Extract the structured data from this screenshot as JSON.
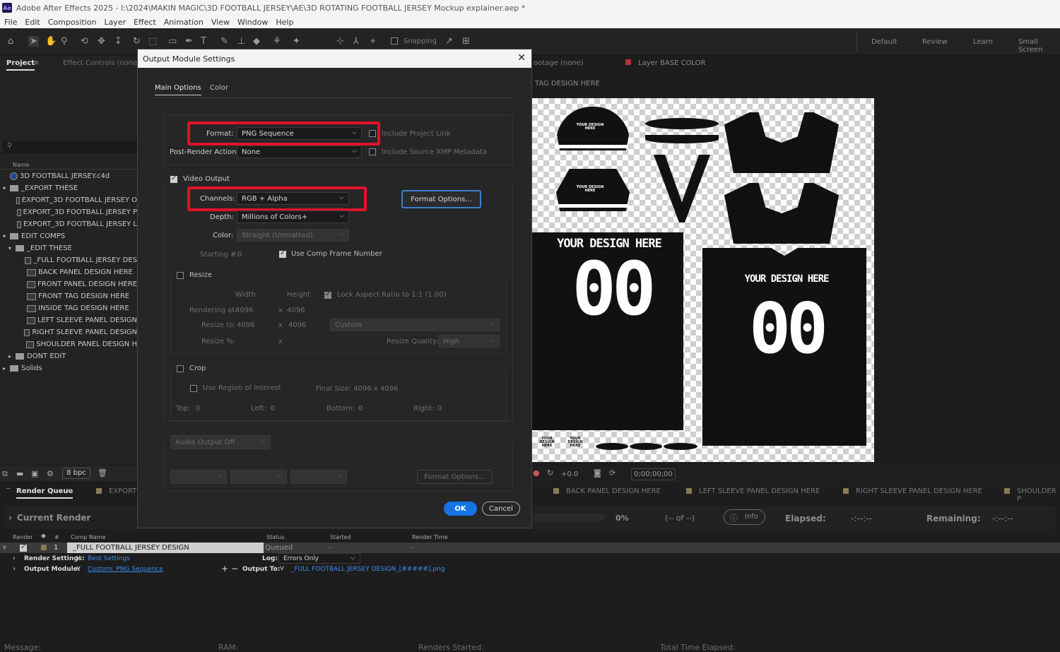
{
  "app": {
    "title": "Adobe After Effects 2025 - I:\\2024\\MAKIN MAGIC\\3D FOOTBALL JERSEY\\AE\\3D ROTATING FOOTBALL JERSEY Mockup explainer.aep *",
    "logo": "Ae"
  },
  "menu": [
    "File",
    "Edit",
    "Composition",
    "Layer",
    "Effect",
    "Animation",
    "View",
    "Window",
    "Help"
  ],
  "toolbar": {
    "snapping": "Snapping",
    "workspaces": [
      "Default",
      "Review",
      "Learn",
      "Small Screen"
    ]
  },
  "project": {
    "tab": "Project",
    "effect_tab": "Effect Controls (none)",
    "name_header": "Name",
    "search_placeholder": "",
    "items": [
      {
        "label": "3D FOOTBALL JERSEY.c4d",
        "type": "file",
        "indent": 0,
        "tri": ""
      },
      {
        "label": "_EXPORT THESE",
        "type": "folder",
        "indent": 0,
        "tri": "v"
      },
      {
        "label": "EXPORT_3D FOOTBALL JERSEY O",
        "type": "comp",
        "indent": 2,
        "tri": ""
      },
      {
        "label": "EXPORT_3D FOOTBALL JERSEY P",
        "type": "comp",
        "indent": 2,
        "tri": ""
      },
      {
        "label": "EXPORT_3D FOOTBALL JERSEY L",
        "type": "comp",
        "indent": 2,
        "tri": ""
      },
      {
        "label": "EDIT COMPS",
        "type": "folder",
        "indent": 0,
        "tri": "v"
      },
      {
        "label": "_EDIT THESE",
        "type": "folder",
        "indent": 1,
        "tri": "v"
      },
      {
        "label": "_FULL FOOTBALL JERSEY DES",
        "type": "comp",
        "indent": 3,
        "tri": ""
      },
      {
        "label": "BACK PANEL DESIGN HERE",
        "type": "comp",
        "indent": 3,
        "tri": ""
      },
      {
        "label": "FRONT PANEL DESIGN HERE",
        "type": "comp",
        "indent": 3,
        "tri": ""
      },
      {
        "label": "FRONT TAG DESIGN HERE",
        "type": "comp",
        "indent": 3,
        "tri": ""
      },
      {
        "label": "INSIDE TAG DESIGN HERE",
        "type": "comp",
        "indent": 3,
        "tri": ""
      },
      {
        "label": "LEFT SLEEVE PANEL DESIGN",
        "type": "comp",
        "indent": 3,
        "tri": ""
      },
      {
        "label": "RIGHT SLEEVE PANEL DESIGN",
        "type": "comp",
        "indent": 3,
        "tri": ""
      },
      {
        "label": "SHOULDER PANEL DESIGN H",
        "type": "comp",
        "indent": 3,
        "tri": ""
      },
      {
        "label": "DONT EDIT",
        "type": "folder",
        "indent": 1,
        "tri": ">"
      },
      {
        "label": "Solids",
        "type": "folder",
        "indent": 0,
        "tri": ">"
      }
    ],
    "bpc": "8 bpc"
  },
  "comp_header": {
    "footage": "ootage (none)",
    "layer": "Layer BASE COLOR",
    "tab": "TAG DESIGN HERE"
  },
  "viewer": {
    "design_text": "YOUR DESIGN HERE",
    "number": "00",
    "small_text": "YOUR DESIGN HERE",
    "exposure": "+0.0",
    "timecode": "0;00;00;00"
  },
  "dialog": {
    "title": "Output Module Settings",
    "tabs": [
      "Main Options",
      "Color"
    ],
    "format_label": "Format:",
    "format_value": "PNG Sequence",
    "include_project_link": "Include Project Link",
    "post_render_label": "Post-Render Action:",
    "post_render_value": "None",
    "include_xmp": "Include Source XMP Metadata",
    "video_output": "Video Output",
    "channels_label": "Channels:",
    "channels_value": "RGB + Alpha",
    "format_options": "Format Options...",
    "depth_label": "Depth:",
    "depth_value": "Millions of Colors+",
    "color_label": "Color:",
    "color_value": "Straight (Unmatted)",
    "starting_label": "Starting #:",
    "starting_value": "0",
    "use_comp_frame": "Use Comp Frame Number",
    "resize": "Resize",
    "width": "Width",
    "height": "Height",
    "lock_aspect": "Lock Aspect Ratio to 1:1 (1.00)",
    "rendering_at": "Rendering at:",
    "rendering_w": "4096",
    "x": "x",
    "rendering_h": "4096",
    "resize_to": "Resize to:",
    "resize_w": "4096",
    "resize_h": "4096",
    "resize_preset": "Custom",
    "resize_pct": "Resize %:",
    "resize_quality_label": "Resize Quality:",
    "resize_quality": "High",
    "crop": "Crop",
    "use_roi": "Use Region of Interest",
    "final_size": "Final Size: 4096 x 4096",
    "top": "Top:",
    "left": "Left:",
    "bottom": "Bottom:",
    "right": "Right:",
    "zero": "0",
    "audio_output": "Audio Output Off",
    "audio_format_options": "Format Options...",
    "ok": "OK",
    "cancel": "Cancel"
  },
  "render_queue": {
    "tab": "Render Queue",
    "export_tab": "EXPORT",
    "comp_tabs": [
      "BACK PANEL DESIGN HERE",
      "LEFT SLEEVE PANEL DESIGN HERE",
      "RIGHT SLEEVE PANEL DESIGN HERE",
      "SHOULDER P"
    ],
    "current_render": "Current Render",
    "percent": "0%",
    "of": "(-- of --)",
    "info": "Info",
    "elapsed_label": "Elapsed:",
    "elapsed": "-:--:--",
    "remaining_label": "Remaining:",
    "remaining": "-:--:--",
    "headers": {
      "render": "Render",
      "num": "#",
      "comp": "Comp Name",
      "status": "Status",
      "started": "Started",
      "render_time": "Render Time"
    },
    "row": {
      "num": "1",
      "comp": "_FULL FOOTBALL JERSEY DESIGN",
      "status": "Queued",
      "started": "-",
      "render_time": "-"
    },
    "render_settings_label": "Render Settings:",
    "render_settings": "Best Settings",
    "log_label": "Log:",
    "log": "Errors Only",
    "output_module_label": "Output Module:",
    "output_module": "Custom: PNG Sequence",
    "output_to_label": "Output To:",
    "output_to": "_FULL FOOTBALL JERSEY DESIGN_[#####].png",
    "footer": {
      "message": "Message:",
      "ram": "RAM:",
      "renders_started": "Renders Started:",
      "total_time": "Total Time Elapsed:"
    }
  },
  "colors": {
    "highlight": "#e1122a",
    "ok_button": "#1473e6",
    "link": "#3b8cf0",
    "dialog_bg": "#262626"
  }
}
